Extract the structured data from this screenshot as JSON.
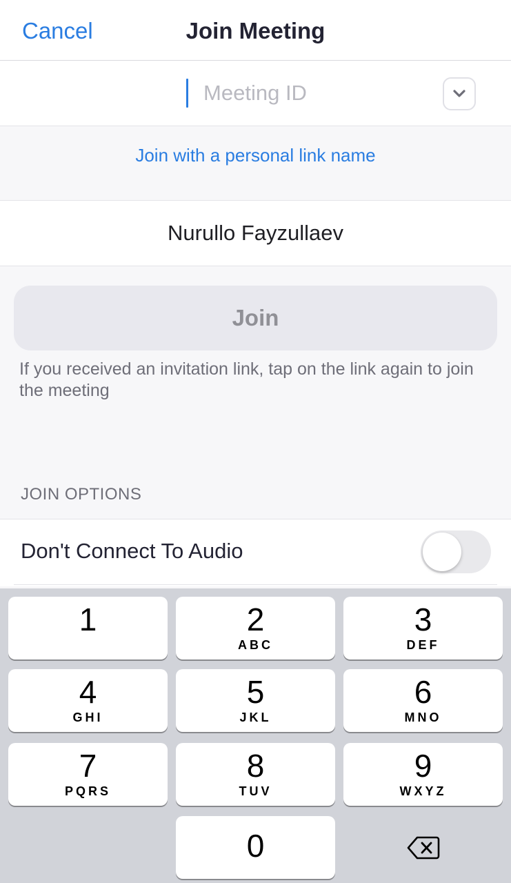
{
  "header": {
    "cancel_label": "Cancel",
    "title": "Join Meeting"
  },
  "meeting_id": {
    "placeholder": "Meeting ID",
    "value": ""
  },
  "personal_link_label": "Join with a personal link name",
  "display_name": {
    "value": "Nurullo Fayzullaev"
  },
  "join_button_label": "Join",
  "hint_text": "If you received an invitation link, tap on the link again to join the meeting",
  "join_options": {
    "section_label": "JOIN OPTIONS",
    "audio_label": "Don't Connect To Audio",
    "audio_toggle_on": false
  },
  "keypad": {
    "keys": [
      {
        "num": "1",
        "letters": ""
      },
      {
        "num": "2",
        "letters": "ABC"
      },
      {
        "num": "3",
        "letters": "DEF"
      },
      {
        "num": "4",
        "letters": "GHI"
      },
      {
        "num": "5",
        "letters": "JKL"
      },
      {
        "num": "6",
        "letters": "MNO"
      },
      {
        "num": "7",
        "letters": "PQRS"
      },
      {
        "num": "8",
        "letters": "TUV"
      },
      {
        "num": "9",
        "letters": "WXYZ"
      },
      {
        "num": "0",
        "letters": ""
      }
    ],
    "backspace_icon": "backspace-icon"
  },
  "colors": {
    "accent": "#2a7de1",
    "join_disabled_bg": "#e8e8ee",
    "keyboard_bg": "#d1d3d9"
  }
}
